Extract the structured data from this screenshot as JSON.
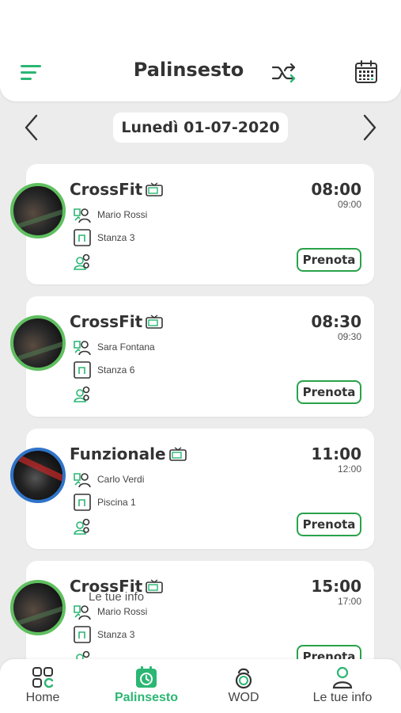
{
  "header": {
    "title": "Palinsesto"
  },
  "date": {
    "label": "Lunedì 01-07-2020"
  },
  "classes": [
    {
      "title": "CrossFit",
      "start": "08:00",
      "end": "09:00",
      "instructor": "Mario Rossi",
      "room": "Stanza 3",
      "action": "Prenota"
    },
    {
      "title": "CrossFit",
      "start": "08:30",
      "end": "09:30",
      "instructor": "Sara Fontana",
      "room": "Stanza 6",
      "action": "Prenota"
    },
    {
      "title": "Funzionale",
      "start": "11:00",
      "end": "12:00",
      "instructor": "Carlo Verdi",
      "room": "Piscina 1",
      "action": "Prenota"
    },
    {
      "title": "CrossFit",
      "start": "15:00",
      "end": "17:00",
      "instructor": "Mario Rossi",
      "room": "Stanza 3",
      "action": "Prenota"
    }
  ],
  "overlay_text": "Le tue info",
  "bottom_nav": [
    {
      "label": "Home",
      "icon": "home-grid-icon"
    },
    {
      "label": "Palinsesto",
      "icon": "calendar-clock-icon"
    },
    {
      "label": "WOD",
      "icon": "kettlebell-icon"
    },
    {
      "label": "Le tue info",
      "icon": "user-icon"
    }
  ],
  "colors": {
    "accent": "#2bb673",
    "button_border": "#2aa24a",
    "avatar_ring": "#5fbf5f",
    "avatar_ring_alt": "#2f73c9"
  }
}
